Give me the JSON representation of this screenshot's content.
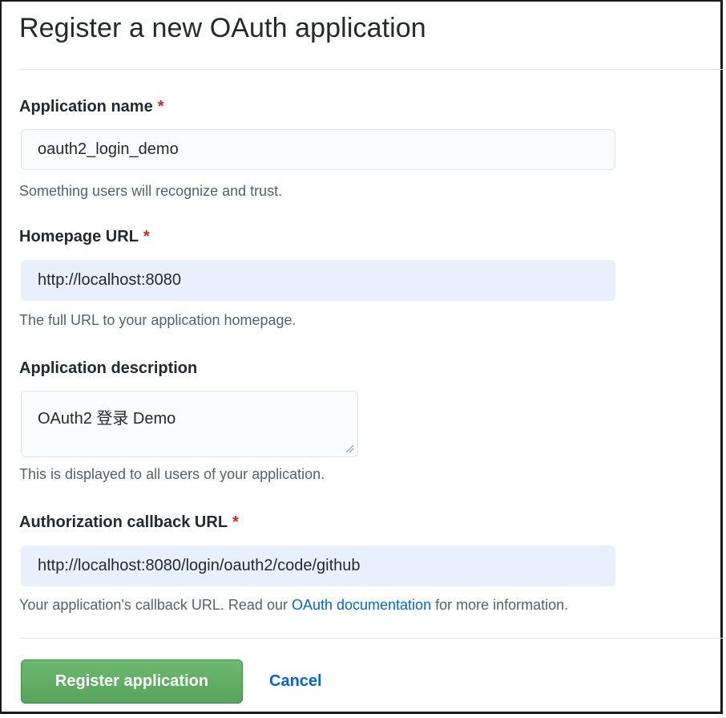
{
  "page": {
    "title": "Register a new OAuth application"
  },
  "form": {
    "app_name": {
      "label": "Application name",
      "required_marker": "*",
      "value": "oauth2_login_demo",
      "note": "Something users will recognize and trust."
    },
    "homepage_url": {
      "label": "Homepage URL",
      "required_marker": "*",
      "value": "http://localhost:8080",
      "note": "The full URL to your application homepage."
    },
    "description": {
      "label": "Application description",
      "value": "OAuth2 登录 Demo",
      "note": "This is displayed to all users of your application."
    },
    "callback_url": {
      "label": "Authorization callback URL",
      "required_marker": "*",
      "value": "http://localhost:8080/login/oauth2/code/github",
      "note_before": "Your application's callback URL. Read our ",
      "note_link": "OAuth documentation",
      "note_after": " for more information."
    }
  },
  "actions": {
    "submit_label": "Register application",
    "cancel_label": "Cancel",
    "submit_color": "#5aa55e",
    "link_color": "#0366d6"
  },
  "icons": {
    "textarea_grip": "resize-grip-icon"
  }
}
